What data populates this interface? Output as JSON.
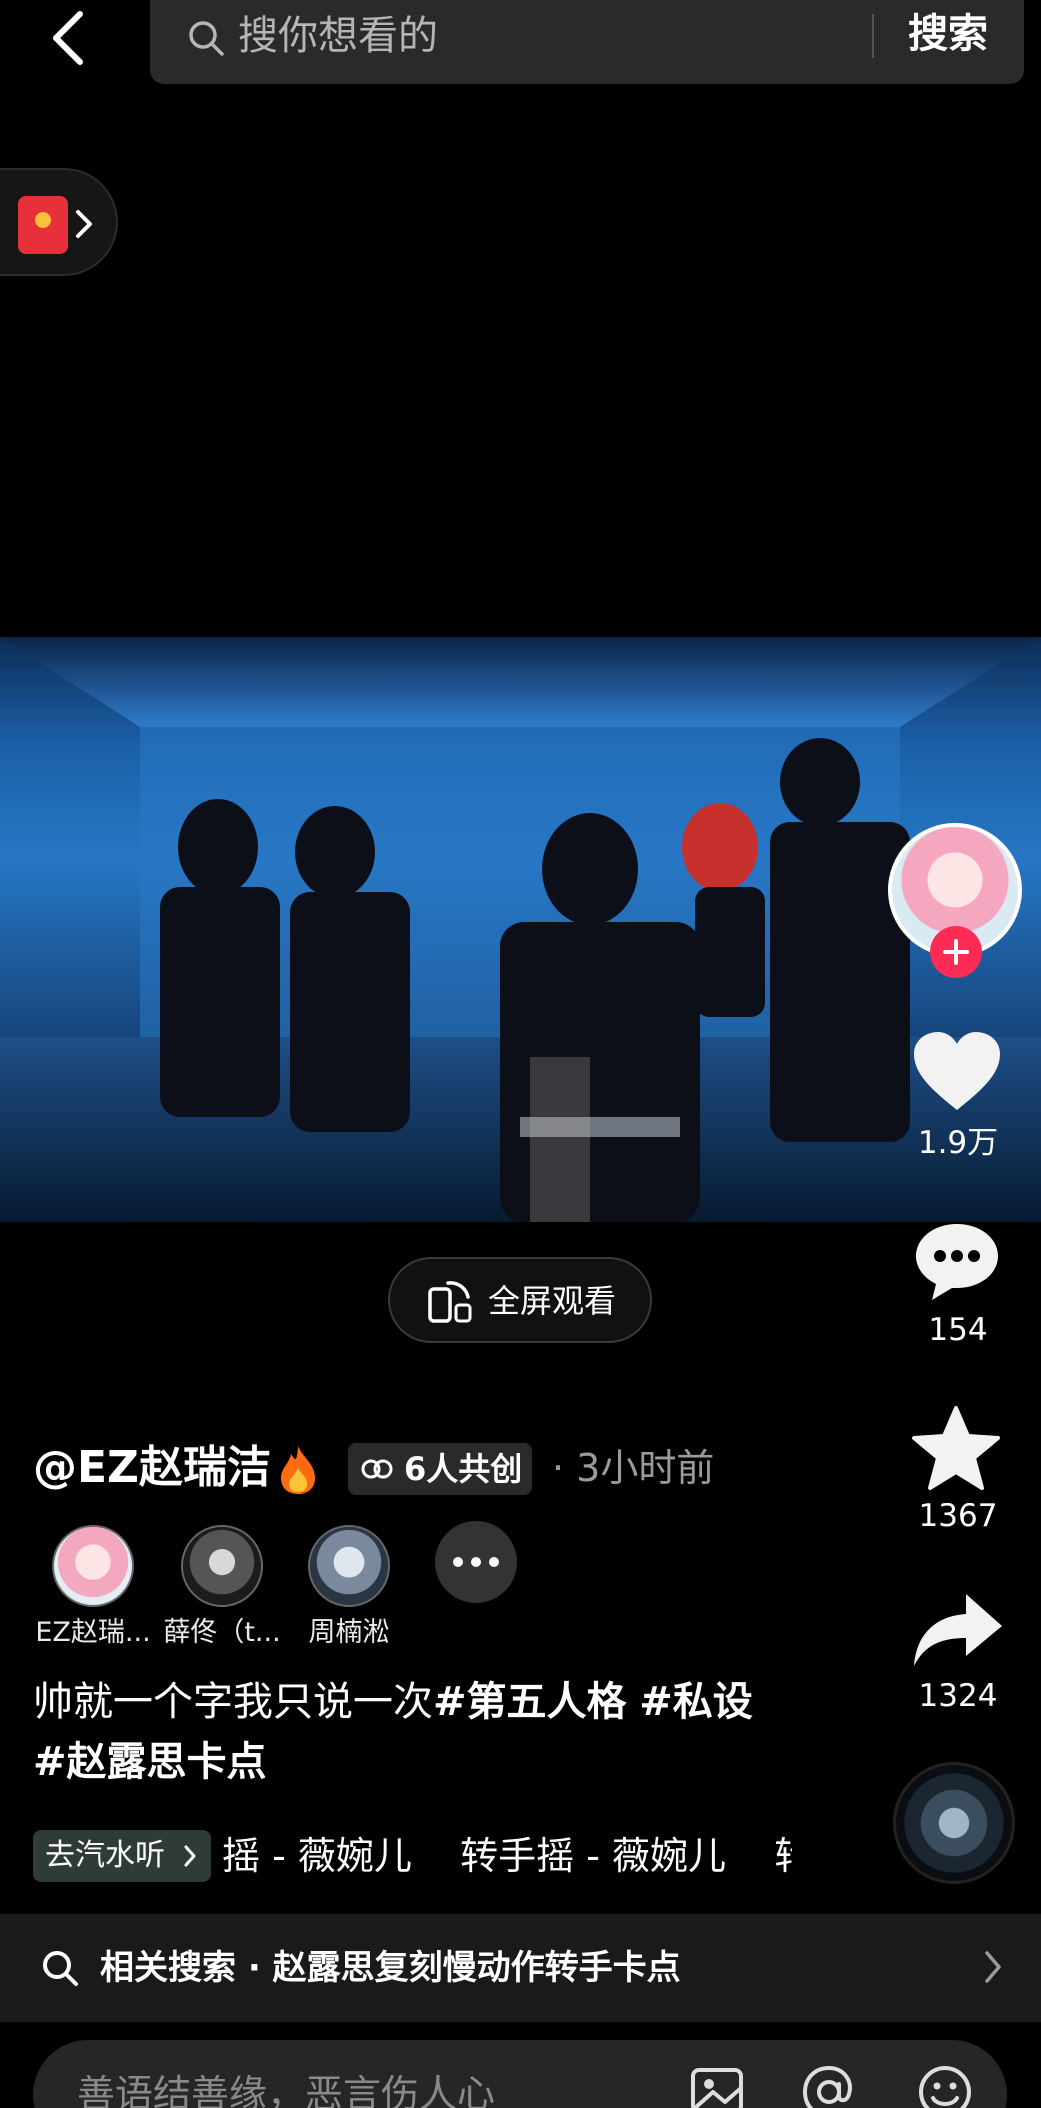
{
  "topbar": {
    "back_icon": "chevron-left-icon",
    "search_placeholder": "搜你想看的",
    "search_button": "搜索"
  },
  "red_packet": {
    "icon": "red-envelope-icon"
  },
  "video": {
    "fullscreen_label": "全屏观看"
  },
  "actions": {
    "likes": "1.9万",
    "comments": "154",
    "favorites": "1367",
    "shares": "1324"
  },
  "author": {
    "name": "@EZ赵瑞洁",
    "cocreate": "6人共创",
    "time": "· 3小时前"
  },
  "creators": [
    {
      "name": "EZ赵瑞..."
    },
    {
      "name": "薛佟（t..."
    },
    {
      "name": "周楠淞"
    }
  ],
  "caption": {
    "text": "帅就一个字我只说一次",
    "tags": [
      "#第五人格",
      "#私设",
      "#赵露思卡点"
    ]
  },
  "music": {
    "listen_label": "去汽水听",
    "ticker": "摇 - 薇婉儿    转手摇 - 薇婉儿    转"
  },
  "related": {
    "text": "相关搜索 · 赵露思复刻慢动作转手卡点"
  },
  "comment": {
    "placeholder": "善语结善缘，恶言伤人心"
  },
  "colors": {
    "background": "#000000",
    "accent": "#fe2c55",
    "search_bg": "#2a2a2a"
  }
}
